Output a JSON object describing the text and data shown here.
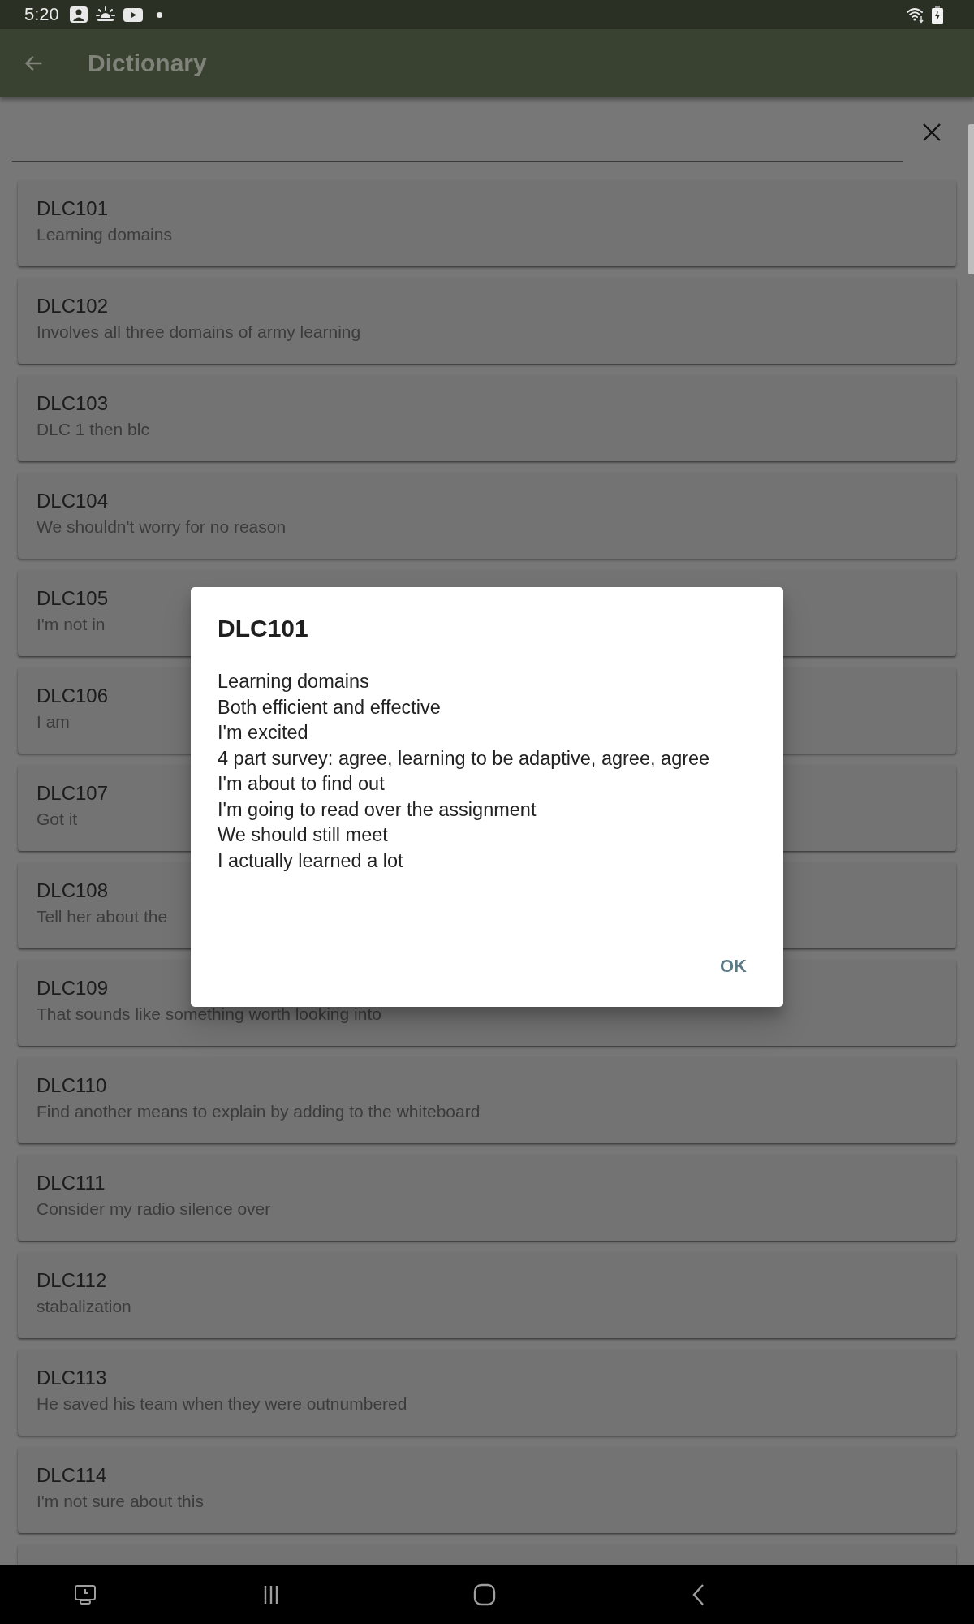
{
  "status_bar": {
    "time": "5:20"
  },
  "app_bar": {
    "title": "Dictionary"
  },
  "entries": [
    {
      "term": "DLC101",
      "definition": "Learning domains"
    },
    {
      "term": "DLC102",
      "definition": "Involves all three domains of army learning"
    },
    {
      "term": "DLC103",
      "definition": "DLC 1 then blc"
    },
    {
      "term": "DLC104",
      "definition": "We shouldn't worry for no reason"
    },
    {
      "term": "DLC105",
      "definition": "I'm not in"
    },
    {
      "term": "DLC106",
      "definition": "I am"
    },
    {
      "term": "DLC107",
      "definition": "Got it"
    },
    {
      "term": "DLC108",
      "definition": "Tell her about the"
    },
    {
      "term": "DLC109",
      "definition": "That sounds like something worth looking into"
    },
    {
      "term": "DLC110",
      "definition": "Find another means to explain by adding to the whiteboard"
    },
    {
      "term": "DLC111",
      "definition": "Consider my radio silence over"
    },
    {
      "term": "DLC112",
      "definition": "stabalization"
    },
    {
      "term": "DLC113",
      "definition": "He saved his team when they were outnumbered"
    },
    {
      "term": "DLC114",
      "definition": "I'm not sure about this"
    }
  ],
  "dialog": {
    "title": "DLC101",
    "lines": [
      "Learning domains",
      "Both efficient and effective",
      "I'm excited",
      "4 part survey: agree, learning to be adaptive, agree, agree",
      "I'm about to find out",
      "I'm going to read over the assignment",
      "We should still meet",
      "I actually learned a lot"
    ],
    "button": "OK"
  }
}
